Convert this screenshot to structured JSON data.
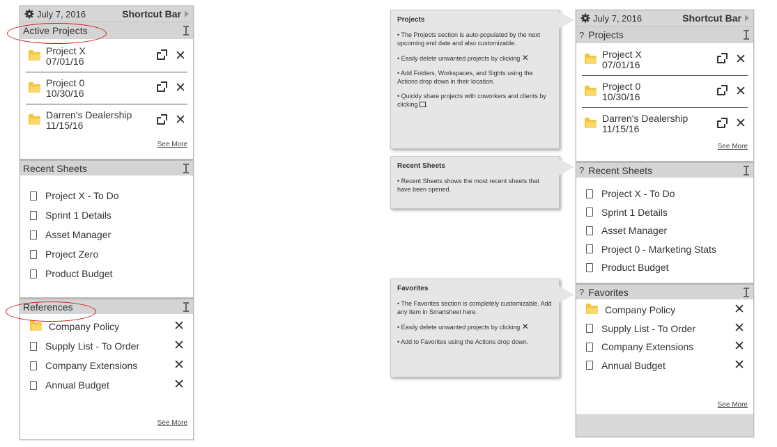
{
  "colors": {
    "header_bg": "#d4d4d4",
    "ellipse": "#d11a1a",
    "folder": "#f5c542",
    "callout_bg": "#e6e6e6"
  },
  "left_panel": {
    "date": "July 7, 2016",
    "shortcut_bar": "Shortcut Bar",
    "active_projects": {
      "title": "Active Projects",
      "items": [
        {
          "name": "Project X",
          "date": "07/01/16"
        },
        {
          "name": "Project 0",
          "date": "10/30/16"
        },
        {
          "name": "Darren's Dealership",
          "date": "11/15/16"
        }
      ],
      "see_more": "See More"
    },
    "recent_sheets": {
      "title": "Recent Sheets",
      "items": [
        "Project X - To Do",
        "Sprint 1 Details",
        "Asset Manager",
        "Project Zero",
        "Product Budget"
      ]
    },
    "references": {
      "title": "References",
      "items": [
        {
          "label": "Company Policy",
          "icon": "folder-icon"
        },
        {
          "label": "Supply List - To Order",
          "icon": "sheet-icon"
        },
        {
          "label": "Company Extensions",
          "icon": "sheet-icon"
        },
        {
          "label": "Annual Budget",
          "icon": "sheet-icon"
        }
      ],
      "see_more": "See More"
    }
  },
  "right_panel": {
    "date": "July 7, 2016",
    "shortcut_bar": "Shortcut Bar",
    "help_mark": "?",
    "projects": {
      "title": "Projects",
      "items": [
        {
          "name": "Project X",
          "date": "07/01/16"
        },
        {
          "name": "Project 0",
          "date": "10/30/16"
        },
        {
          "name": "Darren's Dealership",
          "date": "11/15/16"
        }
      ],
      "see_more": "See More"
    },
    "recent_sheets": {
      "title": "Recent Sheets",
      "items": [
        "Project X - To Do",
        "Sprint 1 Details",
        "Asset Manager",
        "Project 0 - Marketing Stats",
        "Product Budget"
      ]
    },
    "favorites": {
      "title": "Favorites",
      "items": [
        {
          "label": "Company Policy",
          "icon": "folder-icon"
        },
        {
          "label": "Supply List - To Order",
          "icon": "sheet-icon"
        },
        {
          "label": "Company Extensions",
          "icon": "sheet-icon"
        },
        {
          "label": "Annual Budget",
          "icon": "sheet-icon"
        }
      ],
      "see_more": "See More"
    }
  },
  "callouts": {
    "projects": {
      "title": "Projects",
      "p1": "• The Projects section is auto-populated by the next upcoming end date and also customizable.",
      "p2": "• Easily delete unwanted projects by clicking",
      "p3": "• Add Folders, Workspaces, and Sights using the Actions drop down in their location.",
      "p4": "• Quickly share projects with coworkers and clients by clicking",
      "x_glyph": "✕"
    },
    "recent": {
      "title": "Recent Sheets",
      "p1": "• Recent Sheets shows the most recent sheets that have been opened."
    },
    "favorites": {
      "title": "Favorites",
      "p1": "• The Favorites section is completely customizable. Add any item in Smartsheet here.",
      "p2": "• Easily delete unwanted projects by clicking",
      "p3": "• Add to Favorites using the Actions drop down.",
      "x_glyph": "✕"
    }
  },
  "glyphs": {
    "close": "✕"
  }
}
